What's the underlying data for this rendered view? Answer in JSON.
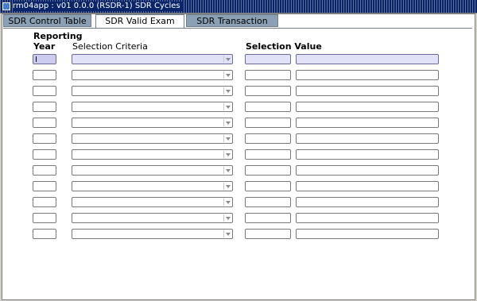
{
  "window": {
    "title": "rm04app : v01 0.0.0 (RSDR-1) SDR Cycles"
  },
  "tabs": [
    {
      "label": "SDR Control Table",
      "active": false
    },
    {
      "label": "SDR Valid Exam Types",
      "active": true
    },
    {
      "label": "SDR Transaction Types",
      "active": false
    }
  ],
  "columns": {
    "year_line1": "Reporting",
    "year_line2": "Year",
    "criteria": "Selection Criteria",
    "value": "Selection Value"
  },
  "rows": [
    {
      "year": "",
      "criteria": "",
      "value": "",
      "value_desc": "",
      "selected": true
    },
    {
      "year": "",
      "criteria": "",
      "value": "",
      "value_desc": "",
      "selected": false
    },
    {
      "year": "",
      "criteria": "",
      "value": "",
      "value_desc": "",
      "selected": false
    },
    {
      "year": "",
      "criteria": "",
      "value": "",
      "value_desc": "",
      "selected": false
    },
    {
      "year": "",
      "criteria": "",
      "value": "",
      "value_desc": "",
      "selected": false
    },
    {
      "year": "",
      "criteria": "",
      "value": "",
      "value_desc": "",
      "selected": false
    },
    {
      "year": "",
      "criteria": "",
      "value": "",
      "value_desc": "",
      "selected": false
    },
    {
      "year": "",
      "criteria": "",
      "value": "",
      "value_desc": "",
      "selected": false
    },
    {
      "year": "",
      "criteria": "",
      "value": "",
      "value_desc": "",
      "selected": false
    },
    {
      "year": "",
      "criteria": "",
      "value": "",
      "value_desc": "",
      "selected": false
    },
    {
      "year": "",
      "criteria": "",
      "value": "",
      "value_desc": "",
      "selected": false
    },
    {
      "year": "",
      "criteria": "",
      "value": "",
      "value_desc": "",
      "selected": false
    }
  ],
  "icons": {
    "app": "app-window-icon",
    "dropdown": "chevron-down-icon"
  },
  "colors": {
    "title_bar": "#0a246a",
    "tab_inactive": "#8aa0b4",
    "selected_row": "#e1e1f8"
  }
}
